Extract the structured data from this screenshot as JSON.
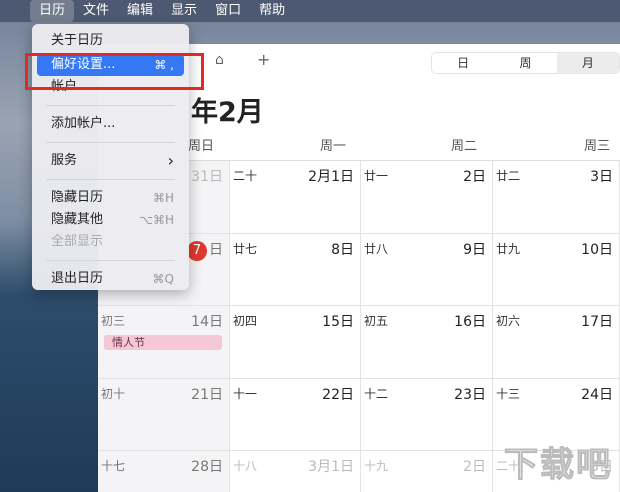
{
  "menubar": {
    "apple": "",
    "items": [
      "日历",
      "文件",
      "编辑",
      "显示",
      "窗口",
      "帮助"
    ]
  },
  "menu": {
    "about": "关于日历",
    "prefs": "偏好设置...",
    "prefs_sc": "⌘ ,",
    "accounts": "帐户...",
    "add_account": "添加帐户...",
    "services": "服务",
    "services_arrow": "›",
    "hide": "隐藏日历",
    "hide_sc": "⌘H",
    "hide_others": "隐藏其他",
    "hide_others_sc": "⌥⌘H",
    "show_all": "全部显示",
    "quit": "退出日历",
    "quit_sc": "⌘Q"
  },
  "toolbar": {
    "inbox": "⌂",
    "add": "+",
    "views": [
      "日",
      "周",
      "月"
    ],
    "selected_view": "月"
  },
  "title": "年2月",
  "weekdays": [
    "周日",
    "周一",
    "周二",
    "周三"
  ],
  "rows": [
    [
      {
        "l": "",
        "d": "31日",
        "dim": true
      },
      {
        "l": "二十",
        "d": "2月1日"
      },
      {
        "l": "廿一",
        "d": "2日"
      },
      {
        "l": "廿二",
        "d": "3日"
      }
    ],
    [
      {
        "l": "",
        "d": "日",
        "today": "7"
      },
      {
        "l": "廿七",
        "d": "8日"
      },
      {
        "l": "廿八",
        "d": "9日"
      },
      {
        "l": "廿九",
        "d": "10日"
      }
    ],
    [
      {
        "l": "初三",
        "d": "14日",
        "event": "情人节"
      },
      {
        "l": "初四",
        "d": "15日"
      },
      {
        "l": "初五",
        "d": "16日"
      },
      {
        "l": "初六",
        "d": "17日"
      }
    ],
    [
      {
        "l": "初十",
        "d": "21日"
      },
      {
        "l": "十一",
        "d": "22日"
      },
      {
        "l": "十二",
        "d": "23日"
      },
      {
        "l": "十三",
        "d": "24日"
      }
    ],
    [
      {
        "l": "十七",
        "d": "28日"
      },
      {
        "l": "十八",
        "d": "3月1日",
        "dim": true
      },
      {
        "l": "十九",
        "d": "2日",
        "dim": true
      },
      {
        "l": "二十",
        "d": "3日",
        "dim": true
      }
    ]
  ],
  "watermark": "下载吧"
}
